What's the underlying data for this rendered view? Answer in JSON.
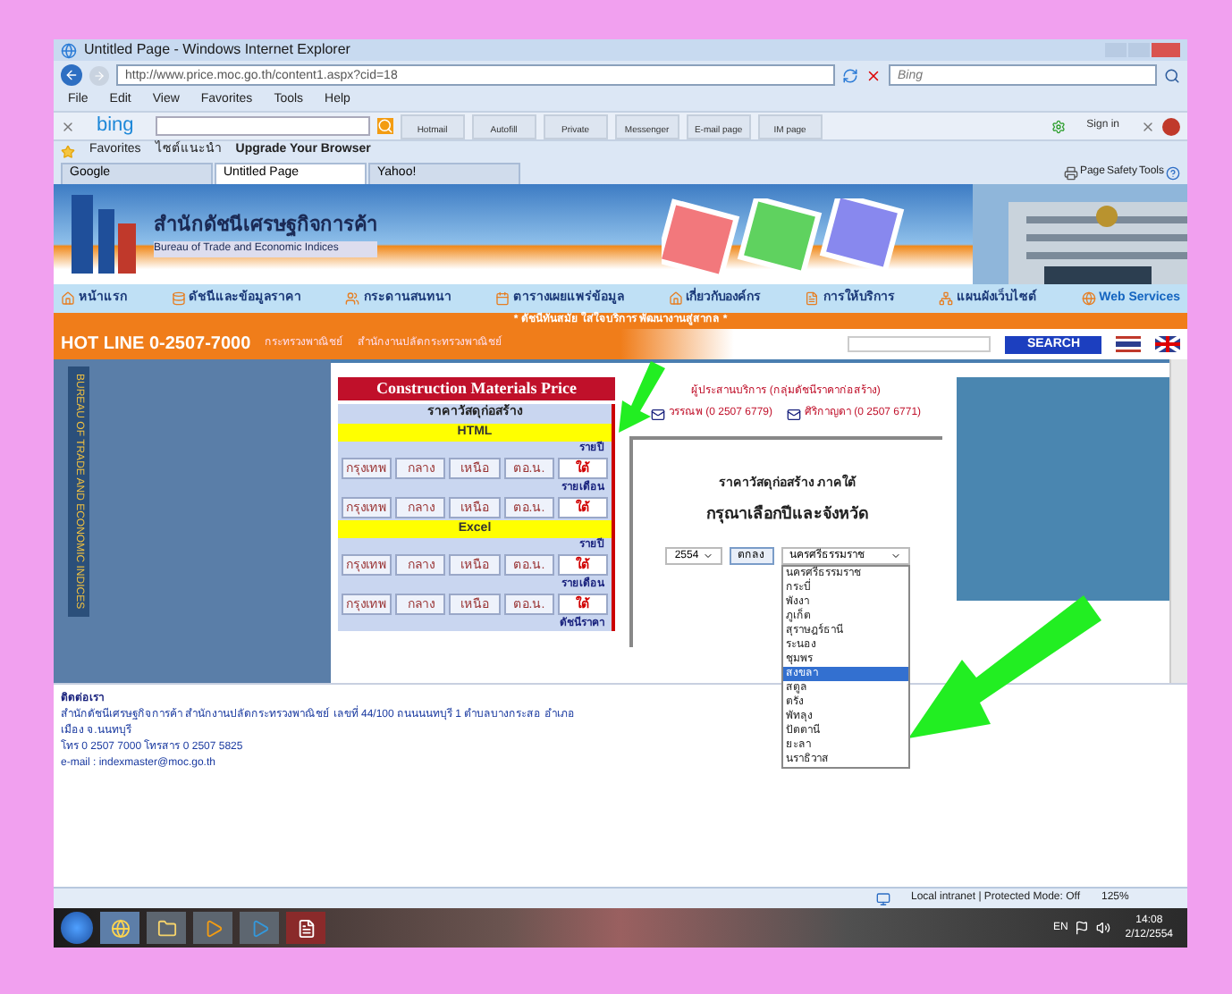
{
  "window": {
    "title": "Untitled Page - Windows Internet Explorer",
    "address": "http://www.price.moc.go.th/content1.aspx?cid=18",
    "search_placeholder": "Bing"
  },
  "menu": [
    "File",
    "Edit",
    "View",
    "Favorites",
    "Tools",
    "Help"
  ],
  "toolbar": {
    "brand": "bing",
    "buttons": [
      "Hotmail",
      "Autofill",
      "Private",
      "Messenger",
      "E-mail page",
      "IM page"
    ],
    "sign_in": "Sign in"
  },
  "favorites_bar": {
    "favorites": "Favorites",
    "links": [
      "ไซต์แนะนำ",
      "Upgrade Your Browser"
    ]
  },
  "tabs": [
    {
      "label": "Google",
      "selected": false
    },
    {
      "label": "Untitled Page",
      "selected": true
    },
    {
      "label": "Yahoo!",
      "selected": false
    }
  ],
  "command_bar": [
    "Page",
    "Safety",
    "Tools"
  ],
  "site": {
    "logo_th": "สำนักดัชนีเศรษฐกิจการค้า",
    "logo_en": "Bureau of Trade and Economic Indices",
    "nav": [
      "หน้าแรก",
      "ดัชนีและข้อมูลราคา",
      "กระดานสนทนา",
      "ตารางเผยแพร่ข้อมูล",
      "เกี่ยวกับองค์กร",
      "การให้บริการ",
      "แผนผังเว็บไซต์",
      "Web Services"
    ],
    "slogan": "* ดัชนีทันสมัย ใส่ใจบริการ พัฒนางานสู่สากล *",
    "hotline": "HOT LINE 0-2507-7000",
    "breadcrumb": [
      "กระทรวงพาณิชย์",
      "สำนักงานปลัดกระทรวงพาณิชย์"
    ],
    "search_button": "SEARCH",
    "side_text": "BUREAU OF TRADE AND ECONOMIC INDICES"
  },
  "price_panel": {
    "title": "Construction Materials Price",
    "subtitle": "ราคาวัสดุก่อสร้าง",
    "sections": [
      {
        "label": "HTML",
        "groups": [
          {
            "period": "รายปี",
            "regions": [
              {
                "label": "กรุงเทพ",
                "selected": false
              },
              {
                "label": "กลาง",
                "selected": false
              },
              {
                "label": "เหนือ",
                "selected": false
              },
              {
                "label": "ตอ.น.",
                "selected": false
              },
              {
                "label": "ใต้",
                "selected": true
              }
            ]
          },
          {
            "period": "รายเดือน",
            "regions": [
              {
                "label": "กรุงเทพ",
                "selected": false
              },
              {
                "label": "กลาง",
                "selected": false
              },
              {
                "label": "เหนือ",
                "selected": false
              },
              {
                "label": "ตอ.น.",
                "selected": false
              },
              {
                "label": "ใต้",
                "selected": true
              }
            ]
          }
        ]
      },
      {
        "label": "Excel",
        "groups": [
          {
            "period": "รายปี",
            "regions": [
              {
                "label": "กรุงเทพ",
                "selected": false
              },
              {
                "label": "กลาง",
                "selected": false
              },
              {
                "label": "เหนือ",
                "selected": false
              },
              {
                "label": "ตอ.น.",
                "selected": false
              },
              {
                "label": "ใต้",
                "selected": true
              }
            ]
          },
          {
            "period": "รายเดือน",
            "regions": [
              {
                "label": "กรุงเทพ",
                "selected": false
              },
              {
                "label": "กลาง",
                "selected": false
              },
              {
                "label": "เหนือ",
                "selected": false
              },
              {
                "label": "ตอ.น.",
                "selected": false
              },
              {
                "label": "ใต้",
                "selected": true
              }
            ]
          }
        ]
      }
    ],
    "footer": "ดัชนีราคา"
  },
  "contacts": {
    "heading": "ผู้ประสานบริการ (กลุ่มดัชนีราคาก่อสร้าง)",
    "people": [
      "วรรณพ (0 2507 6779)",
      "ศิริกาญดา (0 2507 6771)"
    ]
  },
  "selector": {
    "title": "ราคาวัสดุก่อสร้าง ภาคใต้",
    "prompt": "กรุณาเลือกปีและจังหวัด",
    "year": "2554",
    "province": "นครศรีธรรมราช",
    "submit": "ตกลง",
    "options": [
      {
        "label": "นครศรีธรรมราช",
        "selected": false
      },
      {
        "label": "กระบี่",
        "selected": false
      },
      {
        "label": "พังงา",
        "selected": false
      },
      {
        "label": "ภูเก็ต",
        "selected": false
      },
      {
        "label": "สุราษฎร์ธานี",
        "selected": false
      },
      {
        "label": "ระนอง",
        "selected": false
      },
      {
        "label": "ชุมพร",
        "selected": false
      },
      {
        "label": "สงขลา",
        "selected": true
      },
      {
        "label": "สตูล",
        "selected": false
      },
      {
        "label": "ตรัง",
        "selected": false
      },
      {
        "label": "พัทลุง",
        "selected": false
      },
      {
        "label": "ปัตตานี",
        "selected": false
      },
      {
        "label": "ยะลา",
        "selected": false
      },
      {
        "label": "นราธิวาส",
        "selected": false
      }
    ]
  },
  "contact_info": {
    "heading": "ติดต่อเรา",
    "lines": [
      "สำนักดัชนีเศรษฐกิจการค้า สำนักงานปลัดกระทรวงพาณิชย์ เลขที่ 44/100 ถนนนนทบุรี 1 ตำบลบางกระสอ อำเภอเมือง จ.นนทบุรี",
      "โทร 0 2507 7000 โทรสาร 0 2507 5825",
      "e-mail : indexmaster@moc.go.th"
    ]
  },
  "status_bar": {
    "zone": "Local intranet | Protected Mode: Off",
    "zoom": "125%"
  },
  "taskbar": {
    "language": "EN",
    "time": "14:08",
    "date": "2/12/2554"
  }
}
